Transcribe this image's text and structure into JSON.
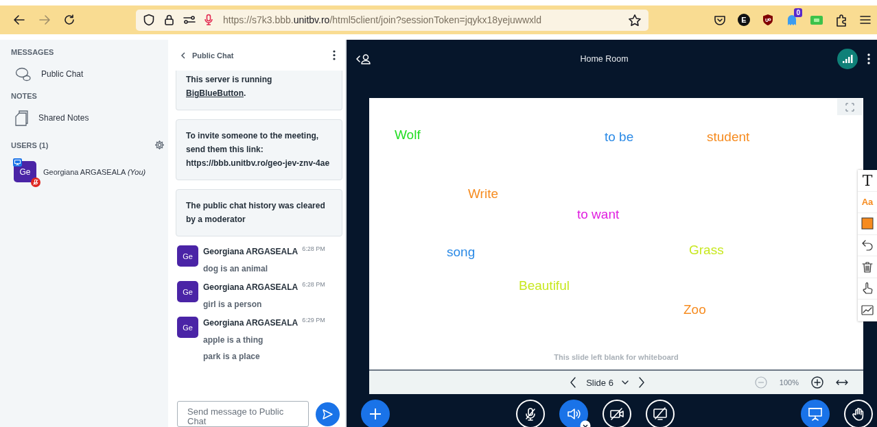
{
  "browser": {
    "url": {
      "prefix": "https://s7k3.bbb.",
      "domain": "unitbv.ro",
      "path": "/html5client/join?sessionToken=jqykx18yejuwwxld"
    },
    "extensions": [
      {
        "kind": "pocket"
      },
      {
        "kind": "letter",
        "label": "E"
      },
      {
        "kind": "shield"
      },
      {
        "kind": "ghost",
        "badge": "0"
      },
      {
        "kind": "green"
      },
      {
        "kind": "puzzle"
      },
      {
        "kind": "menu"
      }
    ]
  },
  "sidebar": {
    "messages_heading": "MESSAGES",
    "messages": [
      {
        "label": "Public Chat"
      }
    ],
    "notes_heading": "NOTES",
    "notes": [
      {
        "label": "Shared Notes"
      }
    ],
    "users_heading": "USERS (1)",
    "users": [
      {
        "initials": "Ge",
        "name": "Georgiana ARGASEALA *(You)*",
        "presenter": true,
        "muted": true
      }
    ]
  },
  "chat": {
    "title": "Public Chat",
    "notices": [
      {
        "text": "This server is running ",
        "link": "BigBlueButton",
        "after": "."
      },
      {
        "text": "To invite someone to the meeting, send them this link: https://bbb.unitbv.ro/geo-jev-znv-4ae"
      },
      {
        "text": "The public chat history was cleared by a moderator"
      }
    ],
    "messages": [
      {
        "initials": "Ge",
        "author": "Georgiana ARGASEALA",
        "time": "6:28 PM",
        "lines": [
          "dog is an animal"
        ]
      },
      {
        "initials": "Ge",
        "author": "Georgiana ARGASEALA",
        "time": "6:28 PM",
        "lines": [
          "girl is a person"
        ]
      },
      {
        "initials": "Ge",
        "author": "Georgiana ARGASEALA",
        "time": "6:29 PM",
        "lines": [
          "apple is a thing",
          "park is a place"
        ]
      }
    ],
    "input": {
      "placeholder": "Send message to Public Chat"
    }
  },
  "meeting": {
    "title": "Home Room",
    "whiteboard": {
      "words": [
        {
          "text": "Wolf",
          "color": "#22dd22"
        },
        {
          "text": "to be",
          "color": "#2b8ae6"
        },
        {
          "text": "student",
          "color": "#f68b1f"
        },
        {
          "text": "Write",
          "color": "#f68b1f"
        },
        {
          "text": "to want",
          "color": "#e020e0"
        },
        {
          "text": "song",
          "color": "#2b8ae6"
        },
        {
          "text": "Grass",
          "color": "#c8e820"
        },
        {
          "text": "Beautiful",
          "color": "#c8e820"
        },
        {
          "text": "Zoo",
          "color": "#f68b1f"
        }
      ],
      "caption": "This slide left blank for whiteboard",
      "tools": [
        {
          "kind": "text",
          "label": "T"
        },
        {
          "kind": "font",
          "label": "Aa"
        },
        {
          "kind": "color"
        },
        {
          "kind": "undo"
        },
        {
          "kind": "trash"
        },
        {
          "kind": "pointer"
        },
        {
          "kind": "chart"
        }
      ]
    },
    "slide_nav": {
      "slide": "Slide 6",
      "zoom": "100%"
    },
    "actions": {
      "kind": "plus"
    },
    "controls": [
      {
        "kind": "mic",
        "active": false
      },
      {
        "kind": "audio",
        "active": true
      },
      {
        "kind": "camera",
        "active": false
      },
      {
        "kind": "screen",
        "active": false
      }
    ],
    "right_controls": [
      {
        "kind": "presentation",
        "active": true
      },
      {
        "kind": "hand",
        "active": false
      }
    ]
  }
}
